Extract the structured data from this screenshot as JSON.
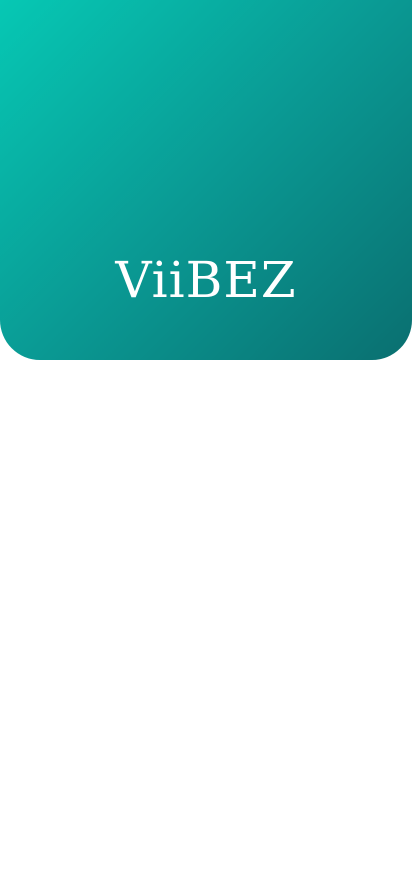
{
  "header": {
    "logo_text": "ViiBEZ",
    "gradient_start": "#06c8b4",
    "gradient_end": "#0a6f70"
  }
}
